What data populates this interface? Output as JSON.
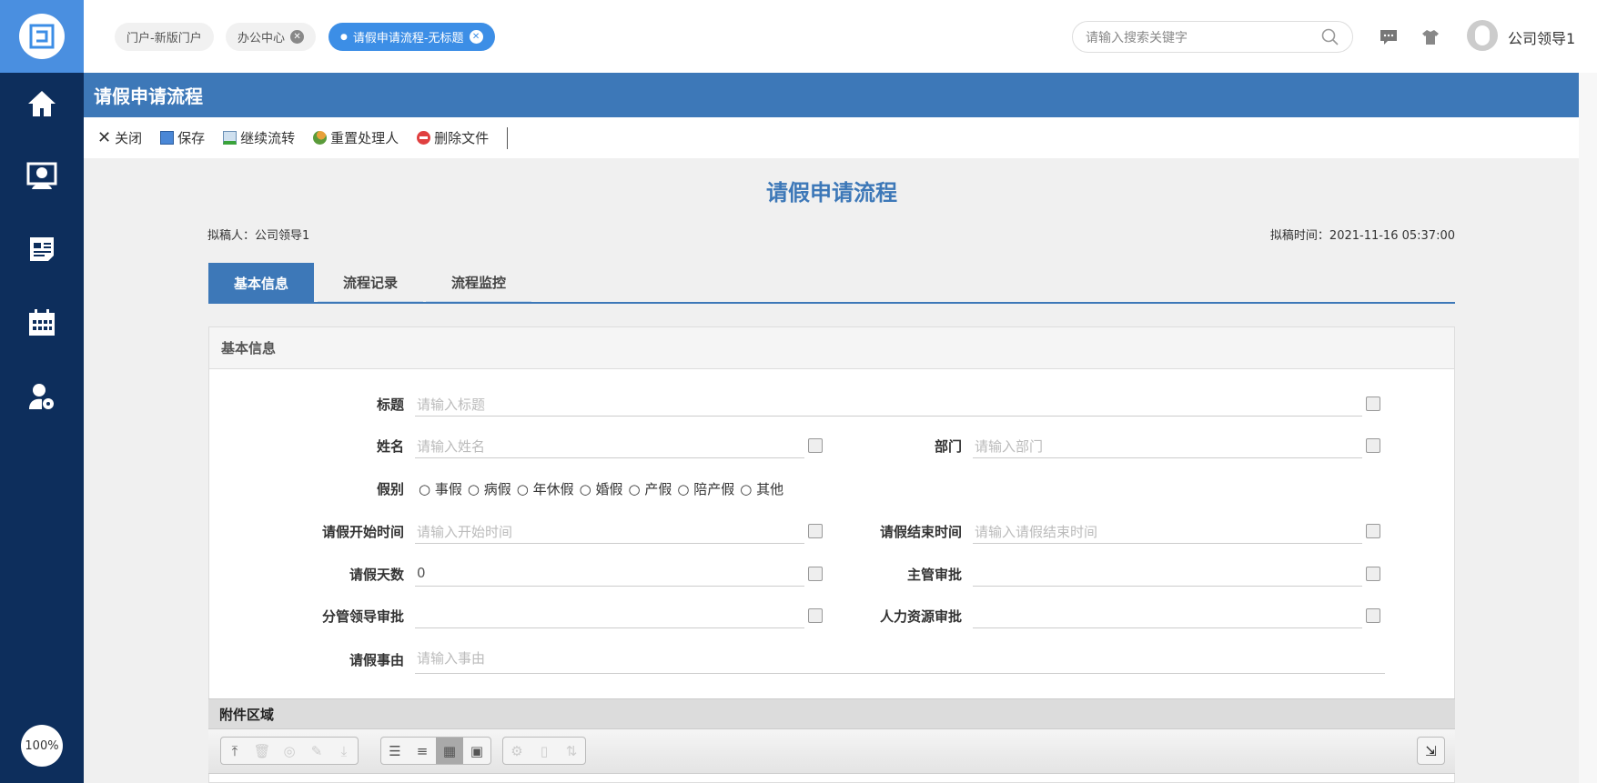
{
  "sidebar": {
    "zoom": "100%",
    "items": [
      "home",
      "desktop",
      "news",
      "calendar",
      "user-settings"
    ]
  },
  "tabs": [
    {
      "label": "门户-新版门户",
      "closable": false
    },
    {
      "label": "办公中心",
      "closable": true
    },
    {
      "label": "请假申请流程-无标题",
      "closable": true,
      "active": true
    }
  ],
  "search": {
    "placeholder": "请输入搜索关键字"
  },
  "user": {
    "name": "公司领导1"
  },
  "titlebar": {
    "title": "请假申请流程"
  },
  "toolbar": {
    "close": "关闭",
    "save": "保存",
    "continue": "继续流转",
    "reset": "重置处理人",
    "delete": "删除文件"
  },
  "form": {
    "title": "请假申请流程",
    "drafter": "拟稿人：公司领导1",
    "draft_time": "拟稿时间：2021-11-16 05:37:00",
    "tabs": [
      "基本信息",
      "流程记录",
      "流程监控"
    ],
    "section": "基本信息",
    "fields": {
      "subject": {
        "label": "标题",
        "placeholder": "请输入标题"
      },
      "name": {
        "label": "姓名",
        "placeholder": "请输入姓名"
      },
      "dept": {
        "label": "部门",
        "placeholder": "请输入部门"
      },
      "type": {
        "label": "假别",
        "options": [
          "事假",
          "病假",
          "年休假",
          "婚假",
          "产假",
          "陪产假",
          "其他"
        ]
      },
      "start": {
        "label": "请假开始时间",
        "placeholder": "请输入开始时间"
      },
      "end": {
        "label": "请假结束时间",
        "placeholder": "请输入请假结束时间"
      },
      "days": {
        "label": "请假天数",
        "value": "0"
      },
      "supervisor": {
        "label": "主管审批",
        "value": ""
      },
      "leader": {
        "label": "分管领导审批",
        "value": ""
      },
      "hr": {
        "label": "人力资源审批",
        "value": ""
      },
      "reason": {
        "label": "请假事由",
        "placeholder": "请输入事由"
      }
    },
    "attachments": {
      "title": "附件区域"
    }
  },
  "colors": {
    "primary": "#3d78b8",
    "sidebar": "#0d2e5c",
    "accent": "#3c8ee6"
  }
}
